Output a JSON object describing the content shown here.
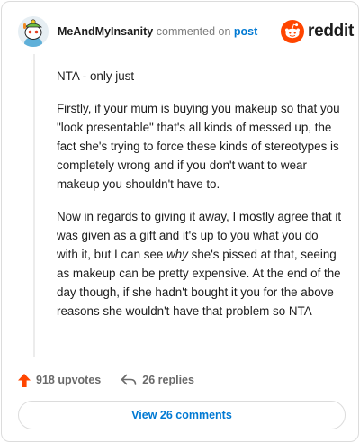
{
  "header": {
    "username": "MeAndMyInsanity",
    "action_text": " commented on ",
    "target_text": "post",
    "brand_word": "reddit",
    "avatar_icon": "snoo-avatar-icon",
    "brand_icon": "reddit-logo-icon"
  },
  "comment": {
    "p1": "NTA - only just",
    "p2": "Firstly, if your mum is buying you makeup so that you \"look presentable\" that's all kinds of messed up, the fact she's trying to force these kinds of stereotypes is completely wrong and if you don't want to wear makeup you shouldn't have to.",
    "p3_before": "Now in regards to giving it away, I mostly agree that it was given as a gift and it's up to you what you do with it, but I can see ",
    "p3_emph": "why",
    "p3_after": " she's pissed at that, seeing as makeup can be pretty expensive. At the end of the day though, if she hadn't bought it you for the above reasons she wouldn't have that problem so NTA"
  },
  "actions": {
    "upvotes": "918 upvotes",
    "replies": "26 replies",
    "upvote_icon": "upvote-arrow-icon",
    "reply_icon": "reply-arrow-icon"
  },
  "footer": {
    "view_comments": "View 26 comments"
  },
  "colors": {
    "brand_orange": "#ff4500",
    "link_blue": "#0079d3",
    "muted_gray": "#7c7c7c"
  }
}
